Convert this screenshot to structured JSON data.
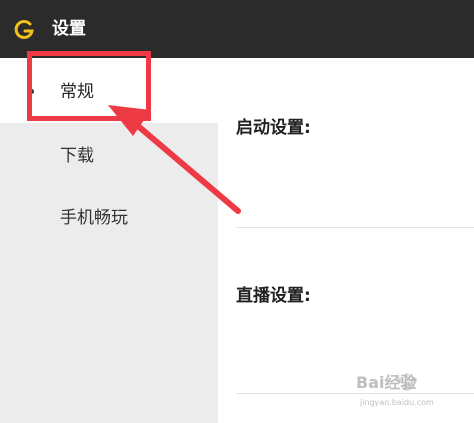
{
  "window": {
    "title": "设置",
    "logo_icon": "g-logo-icon",
    "accent_color": "#f3c11c"
  },
  "sidebar": {
    "items": [
      {
        "label": "常规",
        "active": true
      },
      {
        "label": "下载",
        "active": false
      },
      {
        "label": "手机畅玩",
        "active": false
      }
    ]
  },
  "main": {
    "sections": [
      {
        "title": "启动设置:"
      },
      {
        "title": "直播设置:"
      }
    ]
  },
  "annotation": {
    "highlight_color": "#ee3a44"
  },
  "watermark": {
    "text": "Bai经验",
    "url": "jingyan.baidu.com"
  }
}
